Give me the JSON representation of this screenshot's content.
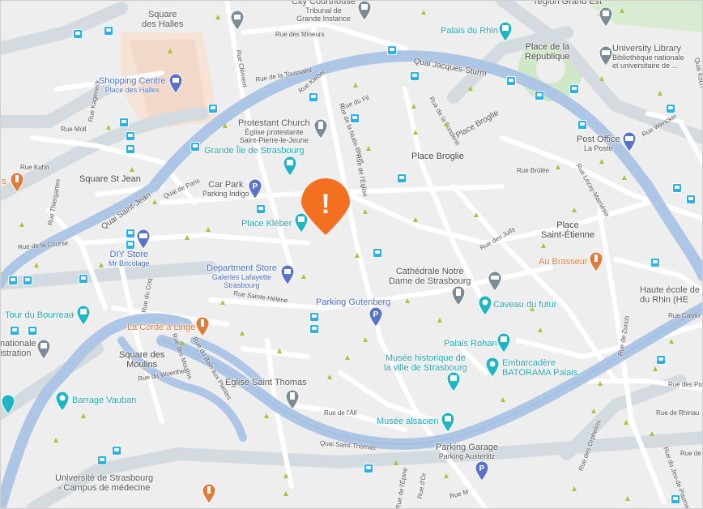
{
  "colors": {
    "water": "#aec6e6",
    "road": "#ffffff",
    "tram_stop": "#2ab1e6",
    "alert": "#f37021",
    "poi_teal": "#1fa7b6",
    "poi_blue": "#5b73c6",
    "poi_gray": "#7c8c96",
    "poi_orange": "#e07b39"
  },
  "alert": {
    "glyph": "!"
  },
  "places": [
    {
      "id": "square-des-halles",
      "text": "Square\ndes Halles",
      "sub": "",
      "color": "gray"
    },
    {
      "id": "shopping-centre",
      "text": "Shopping Centre",
      "sub": "Place des Halles",
      "color": "blue"
    },
    {
      "id": "city-courthouse",
      "text": "City Courthouse",
      "sub": "Tribunal de\nGrande Instance",
      "color": "gray"
    },
    {
      "id": "region-grand-est",
      "text": "région Grand Est",
      "sub": "",
      "color": "gray"
    },
    {
      "id": "palais-du-rhin",
      "text": "Palais du Rhin",
      "sub": "",
      "color": "teal"
    },
    {
      "id": "place-de-la-republique",
      "text": "Place de la\nRépublique",
      "sub": "",
      "color": "dark"
    },
    {
      "id": "university-library",
      "text": "University Library",
      "sub": "Bibliothèque nationale\net universitaire de ...",
      "color": "gray"
    },
    {
      "id": "protestant-church",
      "text": "Protestant Church",
      "sub": "Église protestante\nSaint-Pierre-le-Jeune",
      "color": "gray"
    },
    {
      "id": "grande-ile",
      "text": "Grande Île de Strasbourg",
      "sub": "",
      "color": "teal"
    },
    {
      "id": "place-broglie",
      "text": "Place Broglie",
      "sub": "",
      "color": "dark"
    },
    {
      "id": "post-office",
      "text": "Post Office",
      "sub": "La Poste",
      "color": "gray"
    },
    {
      "id": "square-st-jean",
      "text": "Square St Jean",
      "sub": "",
      "color": "dark"
    },
    {
      "id": "car-park",
      "text": "Car Park",
      "sub": "Parking Indigo",
      "color": "gray"
    },
    {
      "id": "place-kleber",
      "text": "Place Kléber",
      "sub": "",
      "color": "teal"
    },
    {
      "id": "place-saint-etienne",
      "text": "Place\nSaint-Étienne",
      "sub": "",
      "color": "dark"
    },
    {
      "id": "diy-store",
      "text": "DIY Store",
      "sub": "Mr Bricolage",
      "color": "blue"
    },
    {
      "id": "au-brasseur",
      "text": "Au Brasseur",
      "sub": "",
      "color": "orange"
    },
    {
      "id": "department-store",
      "text": "Department Store",
      "sub": "Galeries Lafayette\nStrasbourg",
      "color": "blue"
    },
    {
      "id": "cathedrale",
      "text": "Cathédrale Notre\nDame de Strasbourg",
      "sub": "",
      "color": "gray"
    },
    {
      "id": "haute-ecole",
      "text": "Haute école de\ndu Rhin (HE",
      "sub": "",
      "color": "gray"
    },
    {
      "id": "caveau-du-futur",
      "text": "Caveau du futur",
      "sub": "",
      "color": "teal"
    },
    {
      "id": "tour-du-bourreau",
      "text": "Tour du Bourreau",
      "sub": "",
      "color": "teal"
    },
    {
      "id": "la-corde-a-linge",
      "text": "La Corde à Linge",
      "sub": "",
      "color": "orange"
    },
    {
      "id": "parking-gutenberg",
      "text": "Parking Gutenberg",
      "sub": "",
      "color": "blue"
    },
    {
      "id": "palais-rohan",
      "text": "Palais Rohan",
      "sub": "",
      "color": "teal"
    },
    {
      "id": "nationale-istration",
      "text": "nationale\nistration",
      "sub": "",
      "color": "gray"
    },
    {
      "id": "square-des-moulins",
      "text": "Square des\nMoulins",
      "sub": "",
      "color": "dark"
    },
    {
      "id": "musee-historique",
      "text": "Musée historique de\nla ville de Strasbourg",
      "sub": "",
      "color": "teal"
    },
    {
      "id": "embarcadere",
      "text": "Embarcadère\nBATORAMA Palais...",
      "sub": "",
      "color": "teal"
    },
    {
      "id": "eglise-saint-thomas",
      "text": "Église Saint Thomas",
      "sub": "",
      "color": "gray"
    },
    {
      "id": "barrage-vauban",
      "text": "Barrage Vauban",
      "sub": "",
      "color": "teal"
    },
    {
      "id": "musee-alsacien",
      "text": "Musée alsacien",
      "sub": "",
      "color": "teal"
    },
    {
      "id": "parking-garage",
      "text": "Parking Garage",
      "sub": "Parking Austerlitz",
      "color": "gray"
    },
    {
      "id": "universite",
      "text": "Université de Strasbourg\n- Campus de médecine",
      "sub": "",
      "color": "gray"
    },
    {
      "id": "s-edge",
      "text": "s",
      "sub": "",
      "color": "orange"
    }
  ],
  "streets": [
    {
      "id": "rue-des-mineurs",
      "text": "Rue des Mineurs"
    },
    {
      "id": "rue-clement",
      "text": "Rue Clément"
    },
    {
      "id": "rue-de-la-toussaint",
      "text": "Rue de la Toussaint"
    },
    {
      "id": "rue-kleber",
      "text": "Rue Kléber"
    },
    {
      "id": "quai-jacques-sturm",
      "text": "Quai Jacques-Sturm"
    },
    {
      "id": "rue-kageneck",
      "text": "Rue Kageneck"
    },
    {
      "id": "rue-moll",
      "text": "Rue Moll"
    },
    {
      "id": "rue-du-fil",
      "text": "Rue du Fil"
    },
    {
      "id": "rue-de-la-nuee-bleue",
      "text": "Rue de la Nuée-Bleue"
    },
    {
      "id": "rue-de-la-fonderie",
      "text": "Rue de la Fonderie"
    },
    {
      "id": "place-broglie-street",
      "text": "Place Broglie"
    },
    {
      "id": "rue-wencker",
      "text": "Rue Wencker"
    },
    {
      "id": "quai-koch",
      "text": "Quai Koch"
    },
    {
      "id": "rue-kuhn",
      "text": "Rue Kuhn"
    },
    {
      "id": "rue-thiergarten",
      "text": "Rue Thiergarten"
    },
    {
      "id": "quai-de-paris",
      "text": "Quai de Paris"
    },
    {
      "id": "quai-saint-jean",
      "text": "Quai Saint-Jean"
    },
    {
      "id": "rue-de-l-eglise",
      "text": "Rue de l'Église"
    },
    {
      "id": "rue-brulee",
      "text": "Rue Brûlée"
    },
    {
      "id": "rue-lezay-marnesia",
      "text": "Rue Lezay-Marnésia"
    },
    {
      "id": "rue-de-la-course",
      "text": "Rue de la Course"
    },
    {
      "id": "rue-des-juifs",
      "text": "Rue des Juifs"
    },
    {
      "id": "rue-du-coq",
      "text": "Rue du Coq"
    },
    {
      "id": "rue-sainte-helene",
      "text": "Rue Sainte-Hélène"
    },
    {
      "id": "rue-calvin",
      "text": "Rue Calvin"
    },
    {
      "id": "rue-de-zurich",
      "text": "Rue de Zurich"
    },
    {
      "id": "rue-des-moulins",
      "text": "Rue des Moulins"
    },
    {
      "id": "rue-du-woerthel",
      "text": "Rue du Woerthel"
    },
    {
      "id": "rue-du-bain-aux-plantes",
      "text": "Rue du Bain aux Plantes"
    },
    {
      "id": "rue-de-l-ail",
      "text": "Rue de l'Ail"
    },
    {
      "id": "rue-des-pou",
      "text": "Rue des Pou"
    },
    {
      "id": "rue-de-rhinau",
      "text": "Rue de Rhinau"
    },
    {
      "id": "quai-saint-thomas",
      "text": "Quai Saint-Thomas"
    },
    {
      "id": "rue-des-orphelins",
      "text": "Rue des Orphelins"
    },
    {
      "id": "rue-du-jeu-de-paume",
      "text": "Rue du Jeu-de-Paume"
    },
    {
      "id": "rue-de",
      "text": "Rue de"
    },
    {
      "id": "rue-d-or",
      "text": "Rue d'Or"
    },
    {
      "id": "rue-de-l-epine",
      "text": "Rue de l'Épine"
    },
    {
      "id": "rue-m",
      "text": "Rue M"
    }
  ]
}
